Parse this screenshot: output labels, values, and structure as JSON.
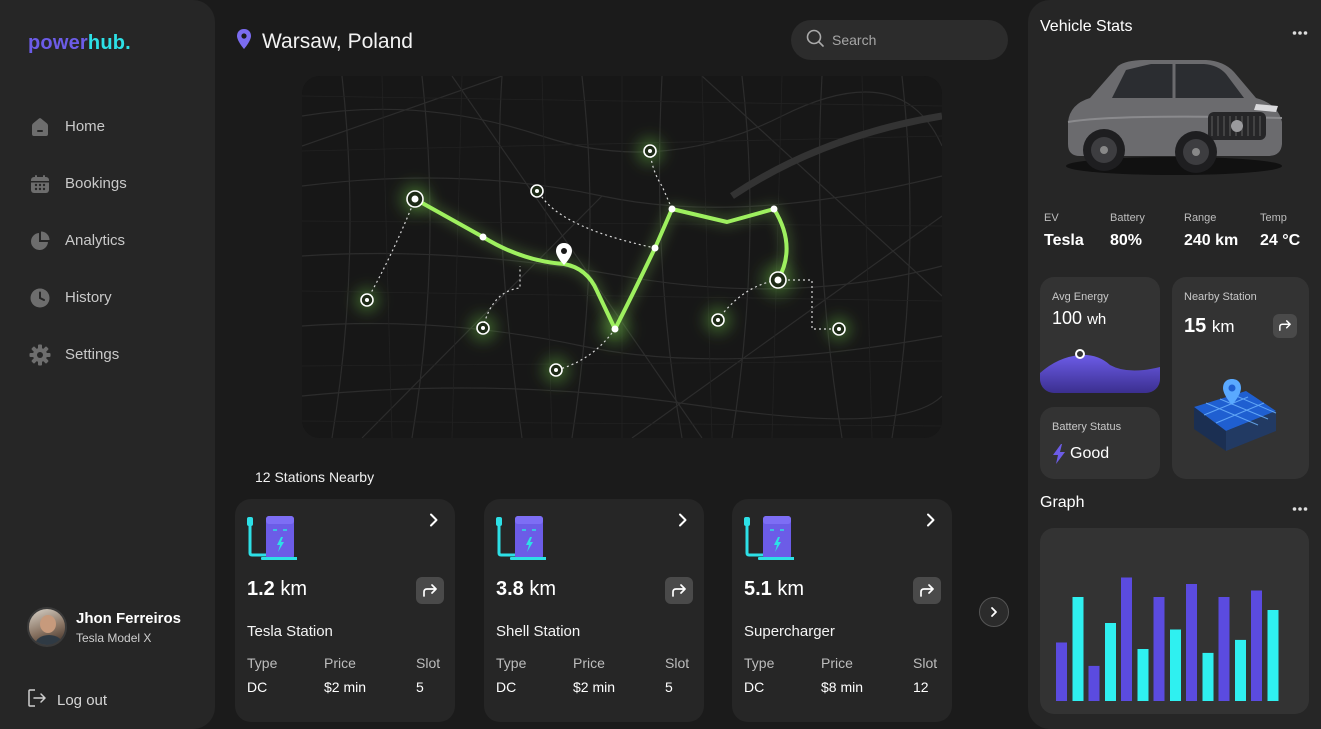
{
  "brand": {
    "part1": "power",
    "part2": "hub."
  },
  "nav": [
    {
      "label": "Home",
      "icon": "home-icon"
    },
    {
      "label": "Bookings",
      "icon": "calendar-icon"
    },
    {
      "label": "Analytics",
      "icon": "pie-chart-icon"
    },
    {
      "label": "History",
      "icon": "clock-icon"
    },
    {
      "label": "Settings",
      "icon": "gear-icon"
    }
  ],
  "user": {
    "name": "Jhon Ferreiros",
    "car": "Tesla Model X"
  },
  "logout_label": "Log out",
  "location": "Warsaw, Poland",
  "search": {
    "placeholder": "Search"
  },
  "stations_title": "12 Stations Nearby",
  "stations": [
    {
      "distance": "1.2",
      "unit": "km",
      "name": "Tesla Station",
      "type_label": "Type",
      "type": "DC",
      "price_label": "Price",
      "price": "$2 min",
      "slot_label": "Slot",
      "slot": "5"
    },
    {
      "distance": "3.8",
      "unit": "km",
      "name": "Shell Station",
      "type_label": "Type",
      "type": "DC",
      "price_label": "Price",
      "price": "$2 min",
      "slot_label": "Slot",
      "slot": "5"
    },
    {
      "distance": "5.1",
      "unit": "km",
      "name": "Supercharger",
      "type_label": "Type",
      "type": "DC",
      "price_label": "Price",
      "price": "$8 min",
      "slot_label": "Slot",
      "slot": "12"
    }
  ],
  "vehicle": {
    "title": "Vehicle Stats",
    "stats": [
      {
        "label": "EV",
        "value": "Tesla"
      },
      {
        "label": "Battery",
        "value": "80%"
      },
      {
        "label": "Range",
        "value": "240 km"
      },
      {
        "label": "Temp",
        "value": "24 °C"
      }
    ]
  },
  "avg_energy": {
    "label": "Avg Energy",
    "value": "100",
    "unit": "wh"
  },
  "nearby_station": {
    "label": "Nearby Station",
    "value": "15",
    "unit": "km"
  },
  "battery_status": {
    "label": "Battery Status",
    "value": "Good"
  },
  "graph": {
    "title": "Graph"
  },
  "colors": {
    "purple": "#6c5ce7",
    "cyan": "#2de0e6",
    "route": "#8fe35a",
    "bg": "#1b1b1b",
    "panel": "#262626"
  },
  "chart_data": {
    "type": "bar",
    "series": [
      {
        "color": "#5b4be0",
        "values": [
          45,
          27,
          95,
          80,
          90,
          80,
          85
        ]
      },
      {
        "color": "#2ff0f0",
        "values": [
          80,
          60,
          40,
          55,
          37,
          47,
          70
        ]
      }
    ]
  }
}
